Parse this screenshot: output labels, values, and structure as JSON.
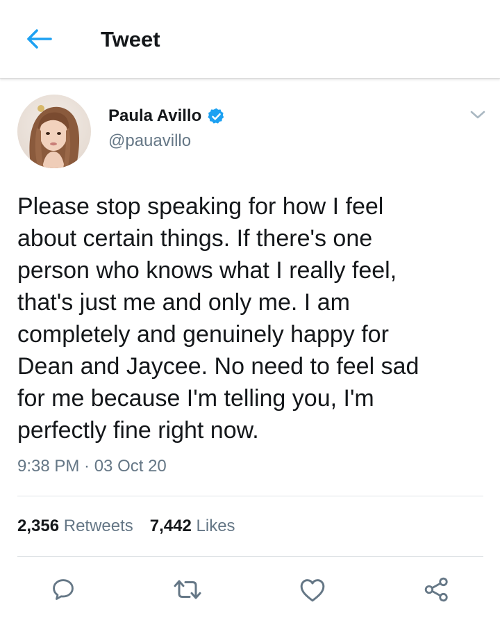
{
  "header": {
    "title": "Tweet",
    "back_icon": "arrow-left-icon"
  },
  "colors": {
    "accent": "#1da1f2",
    "text": "#14171a",
    "muted": "#657786"
  },
  "tweet": {
    "author": {
      "name": "Paula Avillo",
      "handle": "@pauavillo",
      "verified": true
    },
    "text": "Please stop speaking for how I feel\nabout certain things. If there's one\nperson who knows what I really feel,\nthat's just me and only me. I am\ncompletely and genuinely happy for\nDean and Jaycee. No need to feel sad\nfor me because I'm telling you, I'm\nperfectly fine right now.",
    "timestamp": "9:38 PM · 03 Oct 20",
    "stats": {
      "retweets_count": "2,356",
      "retweets_label": "Retweets",
      "likes_count": "7,442",
      "likes_label": "Likes"
    },
    "actions": [
      "reply-icon",
      "retweet-icon",
      "like-icon",
      "share-icon"
    ]
  }
}
